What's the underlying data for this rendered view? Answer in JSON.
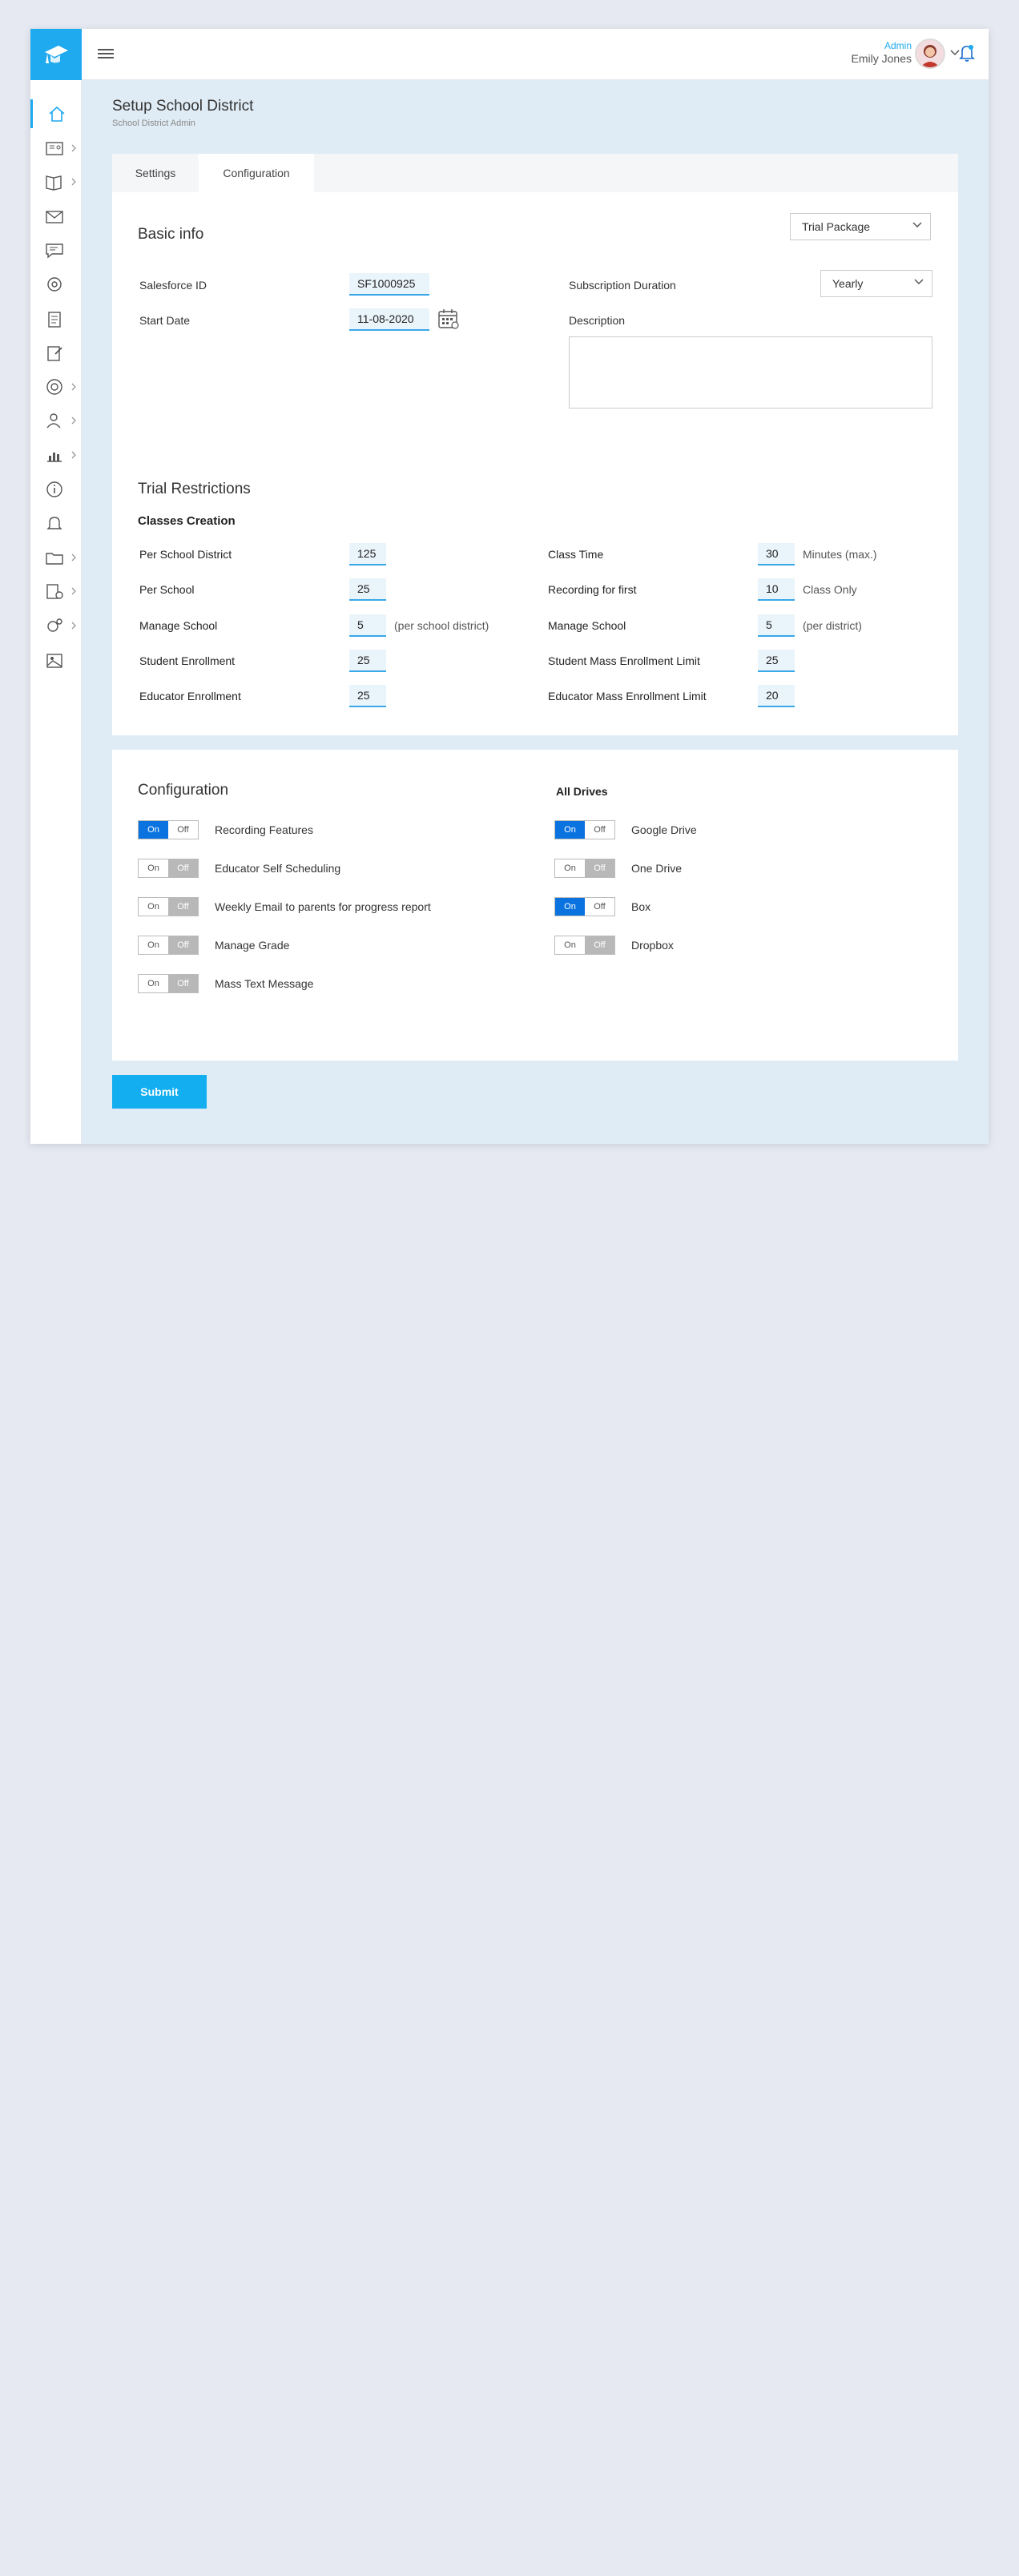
{
  "header": {
    "user_role": "Admin",
    "user_name": "Emily Jones"
  },
  "colors": {
    "accent": "#1fa9ee",
    "toggle_on": "#0a73e0",
    "toggle_off": "#b8b8b8",
    "submit": "#12aef0"
  },
  "sidebar": {
    "items": [
      {
        "icon": "home-icon",
        "has_arrow": false,
        "active": true
      },
      {
        "icon": "classroom-icon",
        "has_arrow": true
      },
      {
        "icon": "book-icon",
        "has_arrow": true
      },
      {
        "icon": "mail-icon",
        "has_arrow": false
      },
      {
        "icon": "chat-icon",
        "has_arrow": false
      },
      {
        "icon": "gear-badge-icon",
        "has_arrow": false
      },
      {
        "icon": "clipboard-icon",
        "has_arrow": false
      },
      {
        "icon": "edit-document-icon",
        "has_arrow": false
      },
      {
        "icon": "support-icon",
        "has_arrow": true
      },
      {
        "icon": "users-icon",
        "has_arrow": true
      },
      {
        "icon": "analytics-icon",
        "has_arrow": true
      },
      {
        "icon": "info-icon",
        "has_arrow": false
      },
      {
        "icon": "bell-icon",
        "has_arrow": false
      },
      {
        "icon": "folder-icon",
        "has_arrow": true
      },
      {
        "icon": "document-settings-icon",
        "has_arrow": true
      },
      {
        "icon": "settings-icon",
        "has_arrow": true
      },
      {
        "icon": "gallery-icon",
        "has_arrow": false
      }
    ]
  },
  "page": {
    "title": "Setup School District",
    "subtitle": "School District Admin"
  },
  "tabs": [
    {
      "label": "Settings",
      "active": false
    },
    {
      "label": "Configuration",
      "active": true
    }
  ],
  "basic_info": {
    "title": "Basic info",
    "package_select": "Trial Package",
    "salesforce_label": "Salesforce ID",
    "salesforce_value": "SF1000925",
    "start_date_label": "Start Date",
    "start_date_value": "11-08-2020",
    "subscription_label": "Subscription Duration",
    "subscription_value": "Yearly",
    "description_label": "Description",
    "description_value": ""
  },
  "trial_restrictions": {
    "title": "Trial Restrictions",
    "subtitle": "Classes Creation",
    "left": [
      {
        "label": "Per School District",
        "value": "125",
        "note": ""
      },
      {
        "label": "Per School",
        "value": "25",
        "note": ""
      },
      {
        "label": "Manage School",
        "value": "5",
        "note": "(per school district)"
      },
      {
        "label": "Student Enrollment",
        "value": "25",
        "note": ""
      },
      {
        "label": "Educator Enrollment",
        "value": "25",
        "note": ""
      }
    ],
    "right": [
      {
        "label": "Class Time",
        "value": "30",
        "note": "Minutes (max.)"
      },
      {
        "label": "Recording for first",
        "value": "10",
        "note": "Class Only"
      },
      {
        "label": "Manage School",
        "value": "5",
        "note": "(per district)"
      },
      {
        "label": "Student Mass Enrollment Limit",
        "value": "25",
        "note": ""
      },
      {
        "label": "Educator Mass Enrollment Limit",
        "value": "20",
        "note": ""
      }
    ]
  },
  "configuration": {
    "title": "Configuration",
    "drives_title": "All Drives",
    "on_label": "On",
    "off_label": "Off",
    "left": [
      {
        "label": "Recording Features",
        "on": true
      },
      {
        "label": "Educator Self Scheduling",
        "on": false
      },
      {
        "label": "Weekly Email to parents for progress report",
        "on": false
      },
      {
        "label": "Manage Grade",
        "on": false
      },
      {
        "label": "Mass Text Message",
        "on": false
      }
    ],
    "right": [
      {
        "label": "Google Drive",
        "on": true
      },
      {
        "label": "One Drive",
        "on": false
      },
      {
        "label": "Box",
        "on": true
      },
      {
        "label": "Dropbox",
        "on": false
      }
    ]
  },
  "submit_label": "Submit"
}
